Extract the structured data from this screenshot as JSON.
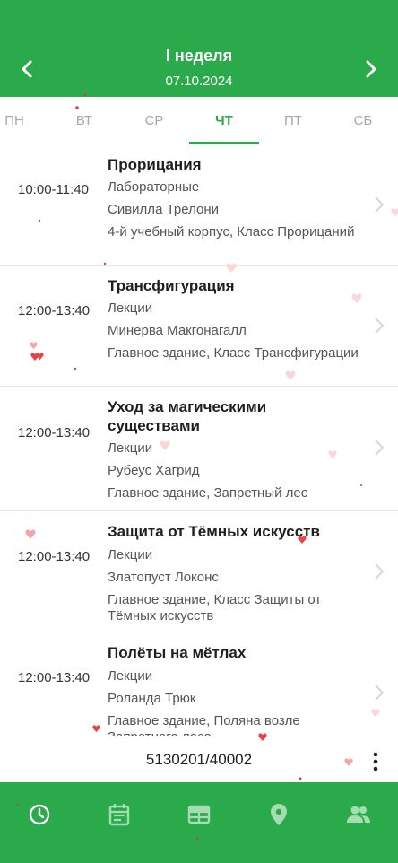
{
  "header": {
    "title": "I неделя",
    "date": "07.10.2024",
    "prev_icon": "chevron-left-icon",
    "next_icon": "chevron-right-icon",
    "background": "#2aaa4a"
  },
  "days": [
    {
      "label": "ПН",
      "active": false
    },
    {
      "label": "ВТ",
      "active": false
    },
    {
      "label": "СР",
      "active": false
    },
    {
      "label": "ЧТ",
      "active": true
    },
    {
      "label": "ПТ",
      "active": false
    },
    {
      "label": "СБ",
      "active": false
    }
  ],
  "lessons": [
    {
      "time": "10:00-11:40",
      "subject": "Прорицания",
      "type": "Лабораторные",
      "teacher": "Сивилла Трелони",
      "location": "4-й учебный корпус, Класс Прорицаний"
    },
    {
      "time": "12:00-13:40",
      "subject": "Трансфигурация",
      "type": "Лекции",
      "teacher": "Минерва Макгонагалл",
      "location": "Главное здание, Класс Трансфигурации"
    },
    {
      "time": "12:00-13:40",
      "subject": "Уход за магическими существами",
      "type": "Лекции",
      "teacher": "Рубеус Хагрид",
      "location": "Главное здание, Запретный лес"
    },
    {
      "time": "12:00-13:40",
      "subject": "Защита от Тёмных искусств",
      "type": "Лекции",
      "teacher": "Златопуст Локонс",
      "location": "Главное здание, Класс Защиты от Тёмных искусств"
    },
    {
      "time": "12:00-13:40",
      "subject": "Полёты на мётлах",
      "type": "Лекции",
      "teacher": "Роланда Трюк",
      "location": "Главное здание, Поляна возле Запретного леса"
    }
  ],
  "footer": {
    "group": "5130201/40002",
    "menu_icon": "more-vertical-icon"
  },
  "bottom_nav": [
    {
      "icon": "clock-icon",
      "active": true
    },
    {
      "icon": "calendar-icon",
      "active": false
    },
    {
      "icon": "schedule-table-icon",
      "active": false
    },
    {
      "icon": "location-pin-icon",
      "active": false
    },
    {
      "icon": "people-icon",
      "active": false
    }
  ],
  "colors": {
    "accent": "#2aaa4a",
    "inactive_day": "#a7a7a7",
    "heart": "#e8454a"
  }
}
